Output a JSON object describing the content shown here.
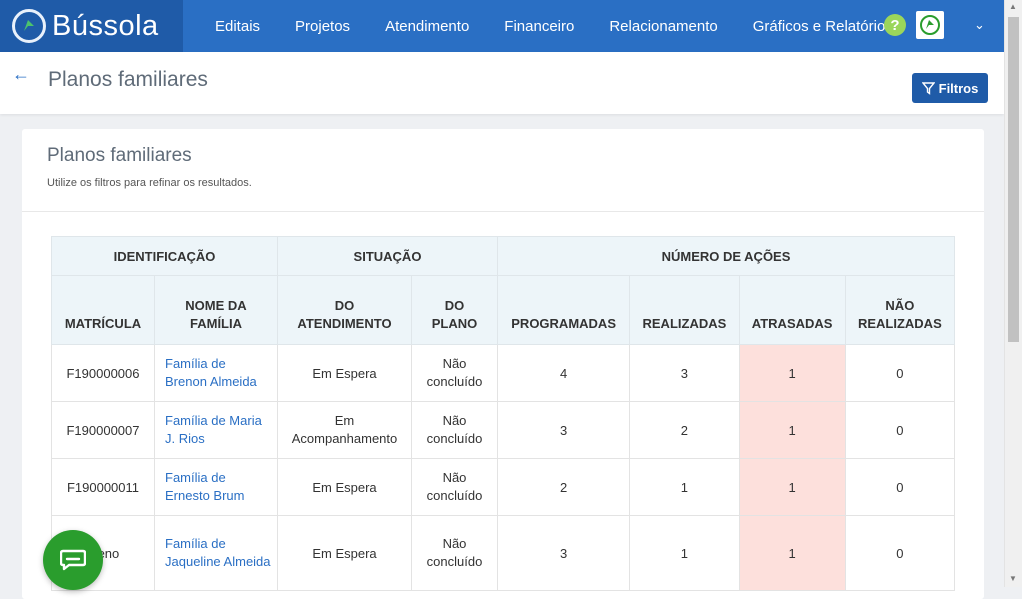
{
  "brand": {
    "name": "Bússola"
  },
  "nav": {
    "items": [
      "Editais",
      "Projetos",
      "Atendimento",
      "Financeiro",
      "Relacionamento",
      "Gráficos e Relatórios"
    ],
    "help_label": "?"
  },
  "header": {
    "title": "Planos familiares",
    "filter_label": "Filtros"
  },
  "card": {
    "title": "Planos familiares",
    "subtitle": "Utilize os filtros para refinar os resultados."
  },
  "table": {
    "groups": [
      "IDENTIFICAÇÃO",
      "SITUAÇÃO",
      "NÚMERO DE AÇÕES"
    ],
    "columns": [
      "MATRÍCULA",
      "NOME DA FAMÍLIA",
      "DO ATENDIMENTO",
      "DO PLANO",
      "PROGRAMADAS",
      "REALIZADAS",
      "ATRASADAS",
      "NÃO REALIZADAS"
    ],
    "rows": [
      {
        "matricula": "F190000006",
        "familia": "Família de Brenon Almeida",
        "atendimento": "Em Espera",
        "plano": "Não concluído",
        "programadas": "4",
        "realizadas": "3",
        "atrasadas": "1",
        "nao_realizadas": "0"
      },
      {
        "matricula": "F190000007",
        "familia": "Família de Maria J. Rios",
        "atendimento": "Em Acompanhamento",
        "plano": "Não concluído",
        "programadas": "3",
        "realizadas": "2",
        "atrasadas": "1",
        "nao_realizadas": "0"
      },
      {
        "matricula": "F190000011",
        "familia": "Família de Ernesto Brum",
        "atendimento": "Em Espera",
        "plano": "Não concluído",
        "programadas": "2",
        "realizadas": "1",
        "atrasadas": "1",
        "nao_realizadas": "0"
      },
      {
        "matricula": "...eno",
        "familia": "Família de Jaqueline Almeida",
        "atendimento": "Em Espera",
        "plano": "Não concluído",
        "programadas": "3",
        "realizadas": "1",
        "atrasadas": "1",
        "nao_realizadas": "0"
      }
    ]
  },
  "colors": {
    "nav": "#2a6fc4",
    "brand_bg": "#1f5ba8",
    "late": "#fde0dc",
    "chat": "#2a9d2d"
  },
  "icons": {
    "back": "arrow-left-icon",
    "filter": "filter-icon",
    "chat": "chat-icon",
    "help": "question-icon",
    "logo": "compass-icon"
  }
}
